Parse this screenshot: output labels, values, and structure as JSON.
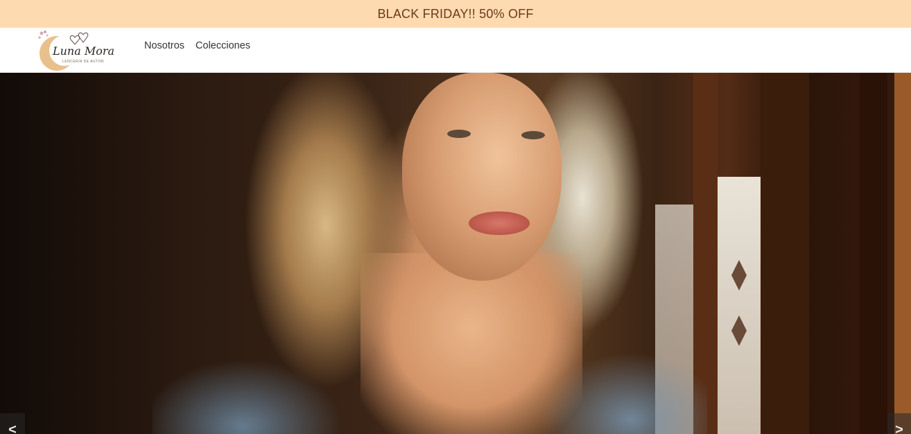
{
  "promo": {
    "text": "BLACK FRIDAY!! 50% OFF"
  },
  "brand": {
    "name": "Luna Mora",
    "tagline": "LENCERÍA DE AUTOR",
    "logo_icon": "moon-with-hearts"
  },
  "nav": {
    "items": [
      {
        "label": "Nosotros"
      },
      {
        "label": "Colecciones"
      }
    ]
  },
  "carousel": {
    "prev_label": "<",
    "next_label": ">"
  },
  "colors": {
    "promo_bg": "#fddab0",
    "promo_text": "#6b3a1a",
    "moon": "#e8c08c"
  }
}
